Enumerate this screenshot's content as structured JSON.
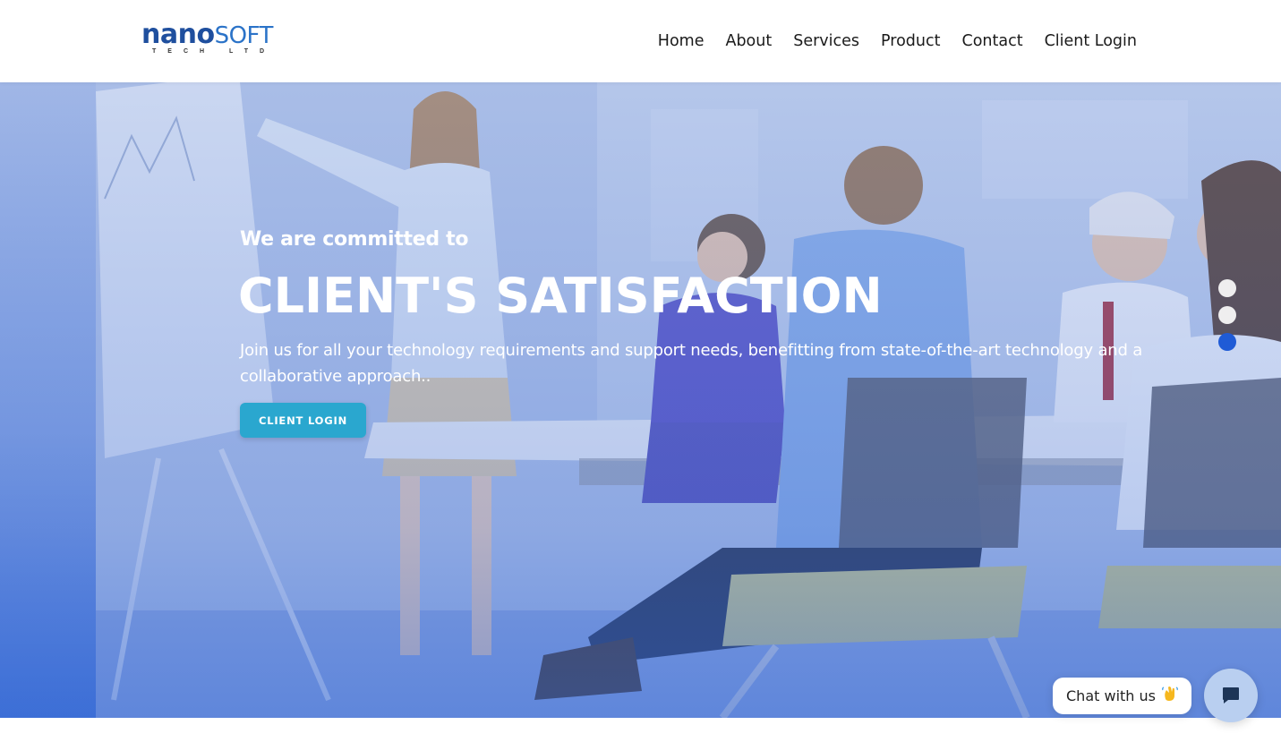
{
  "logo": {
    "brand_main": "nano",
    "brand_soft": "SOFT",
    "brand_sub": "TECH LTD"
  },
  "nav": {
    "items": [
      "Home",
      "About",
      "Services",
      "Product",
      "Contact",
      "Client Login"
    ]
  },
  "hero": {
    "kicker": "We are committed to",
    "title": "CLIENT'S SATISFACTION",
    "description": "Join us for all your technology requirements and support needs, benefitting from state-of-the-art technology and a collaborative approach..",
    "button_label": "CLIENT LOGIN",
    "slider": {
      "slide_count": 3,
      "active_index": 2
    }
  },
  "chat": {
    "bubble_text": "Chat with us",
    "wave_icon": "waving-hand-icon",
    "button_icon": "chat-icon"
  },
  "colors": {
    "brand_dark": "#1f4f9e",
    "brand_light": "#2b73c8",
    "button": "#2aa7cf",
    "active_dot": "#1f5bd6"
  }
}
